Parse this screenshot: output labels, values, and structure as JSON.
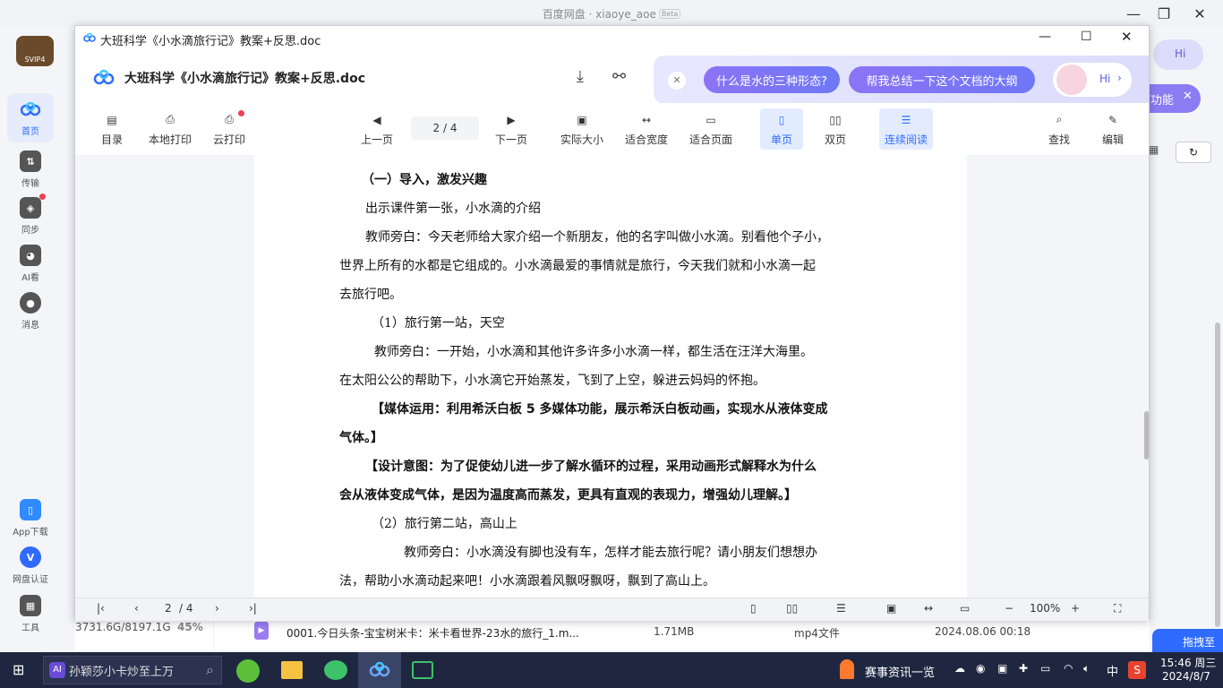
{
  "background_app": {
    "title": "百度网盘 · xiaoye_aoe",
    "beta": "Beta",
    "sidebar": [
      {
        "label": "首页",
        "icon": "home-cloud-icon"
      },
      {
        "label": "传输",
        "icon": "transfer-icon"
      },
      {
        "label": "同步",
        "icon": "sync-icon"
      },
      {
        "label": "AI看",
        "icon": "ai-view-icon"
      },
      {
        "label": "消息",
        "icon": "message-icon"
      },
      {
        "label": "App下载",
        "icon": "phone-icon"
      },
      {
        "label": "网盘认证",
        "icon": "verify-icon"
      },
      {
        "label": "工具",
        "icon": "tools-icon"
      }
    ],
    "storage_used": "3731.6G/8197.1G",
    "storage_percent": "45%",
    "file_row": {
      "name": "0001.今日头条-宝宝树米卡：米卡看世界-23水的旅行_1.m...",
      "size": "1.71MB",
      "type": "mp4文件",
      "date": "2024.08.06 00:18"
    },
    "right_hi": "Hi",
    "right_feature": "功能",
    "right_bottom": "拖拽至"
  },
  "viewer": {
    "window_title": "大班科学《小水滴旅行记》教案+反思.doc",
    "doc_title": "大班科学《小水滴旅行记》教案+反思.doc",
    "ai_suggestions": [
      "什么是水的三种形态?",
      "帮我总结一下这个文档的大纲"
    ],
    "ai_hi": "Hi",
    "toolbar": {
      "toc": "目录",
      "local_print": "本地打印",
      "cloud_print": "云打印",
      "prev_page": "上一页",
      "page_indicator": "2 / 4",
      "next_page": "下一页",
      "actual_size": "实际大小",
      "fit_width": "适合宽度",
      "fit_page": "适合页面",
      "single_page": "单页",
      "double_page": "双页",
      "continuous": "连续阅读",
      "find": "查找",
      "edit": "编辑"
    },
    "document_lines": [
      "（一）导入，激发兴趣",
      "出示课件第一张，小水滴的介绍",
      "教师旁白：今天老师给大家介绍一个新朋友，他的名字叫做小水滴。别看他个子小，",
      "世界上所有的水都是它组成的。小水滴最爱的事情就是旅行，今天我们就和小水滴一起",
      "去旅行吧。",
      "（1）旅行第一站，天空",
      "教师旁白：一开始，小水滴和其他许多许多小水滴一样，都生活在汪洋大海里。",
      "在太阳公公的帮助下，小水滴它开始蒸发，飞到了上空，躲进云妈妈的怀抱。",
      "【媒体运用：利用希沃白板 5 多媒体功能，展示希沃白板动画，实现水从液体变成",
      "气体。】",
      "【设计意图：为了促使幼儿进一步了解水循环的过程，采用动画形式解释水为什么",
      "会从液体变成气体，是因为温度高而蒸发，更具有直观的表现力，增强幼儿理解。】",
      "（2）旅行第二站，高山上",
      "教师旁白：小水滴没有脚也没有车，怎样才能去旅行呢？请小朋友们想想办",
      "法，帮助小水滴动起来吧！小水滴跟着风飘呀飘呀，飘到了高山上。"
    ],
    "status": {
      "page": "2",
      "total": "/ 4",
      "zoom": "100%"
    }
  },
  "taskbar": {
    "search_text": "孙颖莎小卡炒至上万",
    "ai_badge": "AI",
    "news": "赛事资讯一览",
    "ime": "中",
    "time": "15:46 周三",
    "date": "2024/8/7"
  }
}
